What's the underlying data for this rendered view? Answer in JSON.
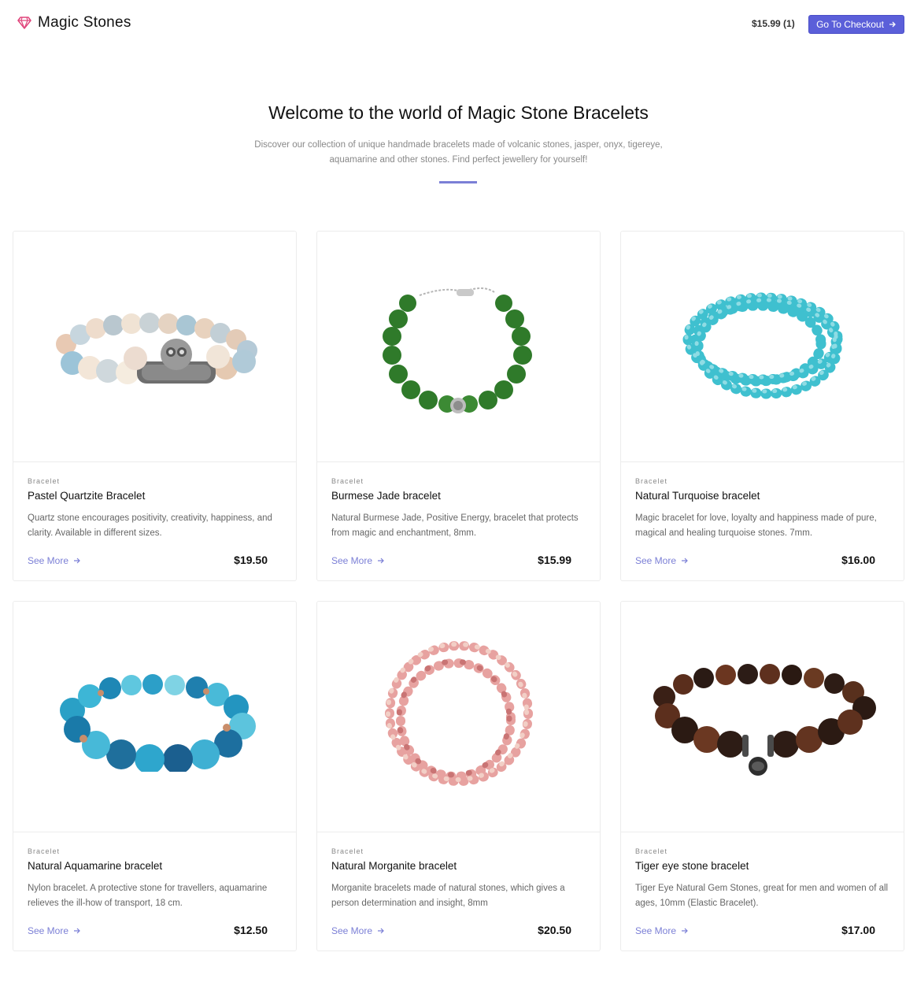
{
  "header": {
    "logo_text": "Magic Stones",
    "cart_summary": "$15.99 (1)",
    "checkout_label": "Go To Checkout"
  },
  "hero": {
    "title": "Welcome to the world of Magic Stone Bracelets",
    "subtitle": "Discover our collection of unique handmade bracelets made of volcanic stones, jasper, onyx, tigereye, aquamarine and other stones. Find perfect jewellery for yourself!"
  },
  "products": [
    {
      "category": "Bracelet",
      "title": "Pastel Quartzite Bracelet",
      "description": "Quartz stone encourages positivity, creativity, happiness, and clarity. Available in different sizes.",
      "link": "See More",
      "price": "$19.50",
      "image": "pastel-quartzite-bracelet"
    },
    {
      "category": "Bracelet",
      "title": "Burmese Jade bracelet",
      "description": "Natural Burmese Jade, Positive Energy, bracelet that protects from magic and enchantment, 8mm.",
      "link": "See More",
      "price": "$15.99",
      "image": "burmese-jade-bracelet"
    },
    {
      "category": "Bracelet",
      "title": "Natural Turquoise bracelet",
      "description": "Magic bracelet for love, loyalty and happiness made of pure, magical and healing turquoise stones. 7mm.",
      "link": "See More",
      "price": "$16.00",
      "image": "turquoise-bracelet"
    },
    {
      "category": "Bracelet",
      "title": "Natural Aquamarine bracelet",
      "description": "Nylon bracelet. A protective stone for travellers, aquamarine relieves the ill-how of transport, 18 cm.",
      "link": "See More",
      "price": "$12.50",
      "image": "aquamarine-bracelet"
    },
    {
      "category": "Bracelet",
      "title": "Natural Morganite bracelet",
      "description": "Morganite bracelets made of natural stones, which gives a person determination and insight, 8mm",
      "link": "See More",
      "price": "$20.50",
      "image": "morganite-bracelet"
    },
    {
      "category": "Bracelet",
      "title": "Tiger eye stone bracelet",
      "description": "Tiger Eye Natural Gem Stones, great for men and women of all ages, 10mm (Elastic Bracelet).",
      "link": "See More",
      "price": "$17.00",
      "image": "tiger-eye-bracelet"
    }
  ],
  "colors": {
    "accent": "#5b5fd9",
    "link": "#7b7fd6",
    "logo_gem": "#e0457b"
  },
  "icons": {
    "logo": "gem-icon",
    "arrow": "arrow-right-icon"
  }
}
